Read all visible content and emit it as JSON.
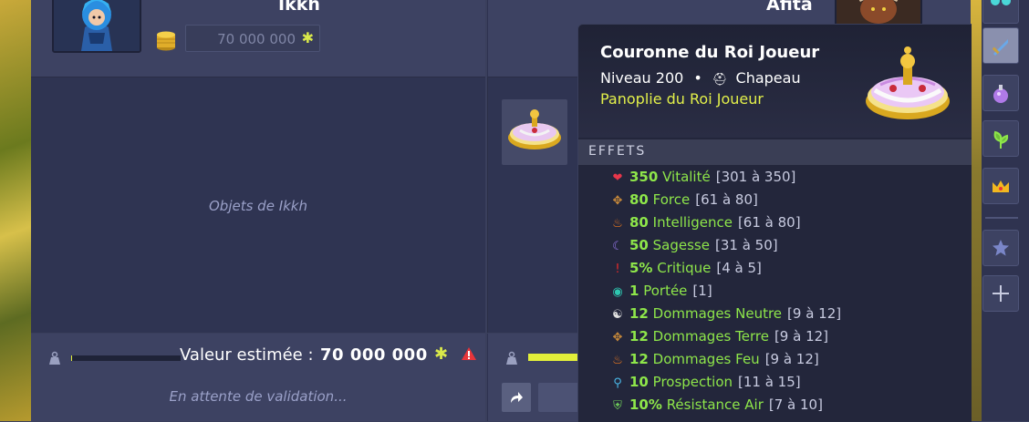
{
  "left_player": {
    "name": "Ikkh",
    "kamas_offer": "70 000 000",
    "empty_items_text": "Objets de Ikkh",
    "estimated_value_label": "Valeur estimée :",
    "estimated_value": "70 000 000",
    "status_text": "En attente de validation...",
    "weight_fill": 0.01
  },
  "right_player": {
    "name": "Afita",
    "weight_fill": 0.5
  },
  "tooltip": {
    "item_name": "Couronne du Roi Joueur",
    "level_text": "Niveau 200",
    "separator": "•",
    "item_type": "Chapeau",
    "set_name": "Panoplie du Roi Joueur",
    "effects_title": "EFFETS",
    "effects": [
      {
        "icon": "heart-icon",
        "glyph": "❤",
        "color": "#e8364a",
        "value": "350",
        "label": "Vitalité",
        "range": "[301 à 350]"
      },
      {
        "icon": "earth-icon",
        "glyph": "✥",
        "color": "#c98a3a",
        "value": "80",
        "label": "Force",
        "range": "[61 à 80]"
      },
      {
        "icon": "fire-icon",
        "glyph": "♨",
        "color": "#f07a1e",
        "value": "80",
        "label": "Intelligence",
        "range": "[61 à 80]"
      },
      {
        "icon": "moon-icon",
        "glyph": "☾",
        "color": "#9b7af0",
        "value": "50",
        "label": "Sagesse",
        "range": "[31 à 50]"
      },
      {
        "icon": "critical-icon",
        "glyph": "!",
        "color": "#e82a2a",
        "value": "5%",
        "label": "Critique",
        "range": "[4 à 5]"
      },
      {
        "icon": "eye-icon",
        "glyph": "◉",
        "color": "#2ec7b0",
        "value": "1",
        "label": "Portée",
        "range": "[1]"
      },
      {
        "icon": "neutral-icon",
        "glyph": "☯",
        "color": "#e0e0e0",
        "value": "12",
        "label": "Dommages Neutre",
        "range": "[9 à 12]"
      },
      {
        "icon": "earth-icon",
        "glyph": "✥",
        "color": "#c98a3a",
        "value": "12",
        "label": "Dommages Terre",
        "range": "[9 à 12]"
      },
      {
        "icon": "fire-icon",
        "glyph": "♨",
        "color": "#f07a1e",
        "value": "12",
        "label": "Dommages Feu",
        "range": "[9 à 12]"
      },
      {
        "icon": "magnifier-icon",
        "glyph": "⚲",
        "color": "#4ab8e8",
        "value": "10",
        "label": "Prospection",
        "range": "[11 à 15]"
      },
      {
        "icon": "shield-air-icon",
        "glyph": "⛨",
        "color": "#6fcf5a",
        "value": "10%",
        "label": "Résistance Air",
        "range": "[7 à 10]"
      }
    ]
  },
  "sidebar": {
    "items": [
      {
        "icon": "glasses-icon"
      },
      {
        "icon": "sword-icon",
        "active": true
      },
      {
        "icon": "potion-icon"
      },
      {
        "icon": "leaf-icon"
      },
      {
        "icon": "crown-icon"
      },
      {
        "icon": "star-icon"
      },
      {
        "icon": "plus-icon"
      }
    ]
  },
  "colors": {
    "stat_green": "#8ee64a",
    "set_yellow": "#e3f04a",
    "kamas_yellow": "#d9e84a"
  }
}
